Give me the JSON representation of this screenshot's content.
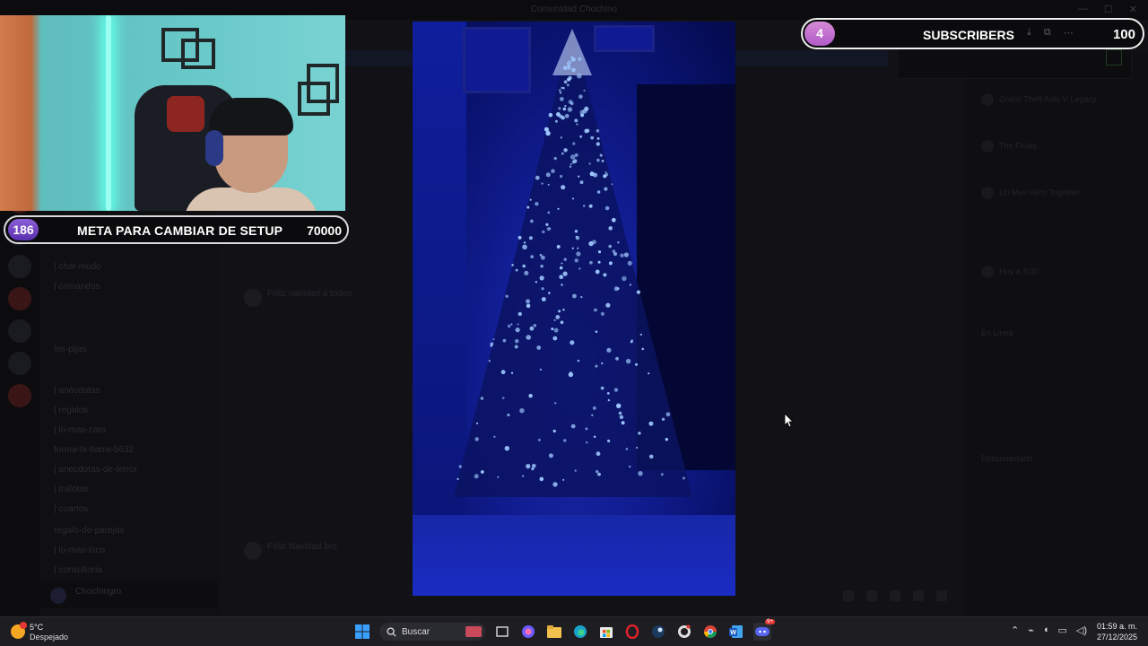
{
  "window": {
    "title": "Comunidad Chochino"
  },
  "overlays": {
    "goal": {
      "count": "186",
      "label": "META PARA CAMBIAR DE SETUP",
      "target": "70000"
    },
    "subscribers": {
      "count": "4",
      "label": "SUBSCRIBERS",
      "target": "100"
    }
  },
  "background_channels": [
    "| chat-modo",
    "| comandos",
    "los-pijas",
    "| anécdotas",
    "| regalos",
    "| lo-mas-caro",
    "forma-la-barra-5632",
    "| anecdotas-de-terror",
    "| trafotas",
    "| cuartos",
    "regalo-de-parejas",
    "| lo-mas-loco",
    "| consultoria"
  ],
  "background_members": [
    "Grand Theft Auto V Legacy",
    "The Finals",
    "Un Mes Hero Together",
    "Hoy a 3:00",
    "En Linea",
    "Desconectado"
  ],
  "background_messages": [
    "Feliz navidad a todos",
    "Feliz Navidad bro"
  ],
  "user": {
    "name": "Chochingro"
  },
  "taskbar": {
    "weather_temp": "5°C",
    "weather_condition": "Despejado",
    "search_placeholder": "Buscar",
    "time": "01:59 a. m.",
    "date": "27/12/2025",
    "notification_badge": "9+"
  },
  "colors": {
    "goal_badge": "#6a3fc4",
    "subs_badge": "#c46dd0",
    "tree_lights": "#9fc8ff"
  }
}
